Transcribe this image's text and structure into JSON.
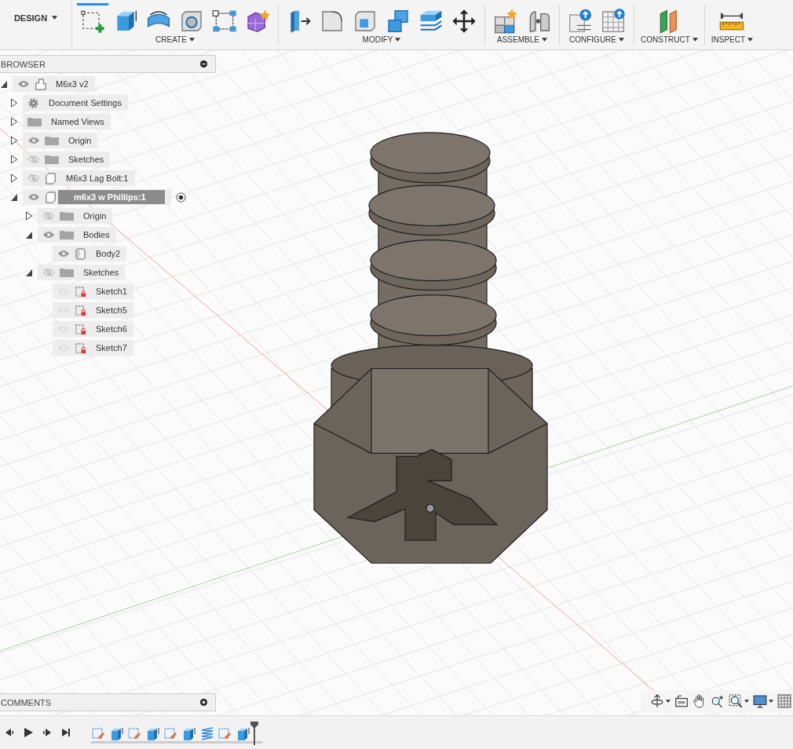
{
  "workspace": {
    "label": "DESIGN"
  },
  "toolbar": [
    {
      "label": "CREATE",
      "tools": [
        {
          "kind": "sketch",
          "selected": true
        },
        {
          "kind": "extrude",
          "selected": false
        },
        {
          "kind": "revolve",
          "selected": false
        },
        {
          "kind": "hole",
          "selected": false
        },
        {
          "kind": "pattern",
          "selected": false
        },
        {
          "kind": "form",
          "selected": false
        }
      ]
    },
    {
      "label": "MODIFY",
      "tools": [
        {
          "kind": "presspull",
          "selected": false
        },
        {
          "kind": "fillet",
          "selected": false
        },
        {
          "kind": "shell",
          "selected": false
        },
        {
          "kind": "combine",
          "selected": false
        },
        {
          "kind": "layers",
          "selected": false
        },
        {
          "kind": "move",
          "selected": false
        }
      ]
    },
    {
      "label": "ASSEMBLE",
      "tools": [
        {
          "kind": "component",
          "selected": false
        },
        {
          "kind": "joint",
          "selected": false
        }
      ]
    },
    {
      "label": "CONFIGURE",
      "tools": [
        {
          "kind": "parameters",
          "selected": false
        },
        {
          "kind": "table",
          "selected": false
        }
      ]
    },
    {
      "label": "CONSTRUCT",
      "tools": [
        {
          "kind": "plane",
          "selected": false
        }
      ]
    },
    {
      "label": "INSPECT",
      "tools": [
        {
          "kind": "measure",
          "selected": false
        }
      ]
    }
  ],
  "browser": {
    "title": "BROWSER",
    "items": [
      {
        "label": "M6x3 v2",
        "kind": "document",
        "visible": true,
        "dimmed": false,
        "expanded": true,
        "selected": false,
        "children": [
          {
            "label": "Document Settings",
            "kind": "settings",
            "expanded": false,
            "selected": false
          },
          {
            "label": "Named Views",
            "kind": "folder",
            "expanded": false,
            "selected": false
          },
          {
            "label": "Origin",
            "kind": "folder",
            "visible": true,
            "dimmed": false,
            "expanded": false,
            "selected": false
          },
          {
            "label": "Sketches",
            "kind": "folder",
            "visible": false,
            "dimmed": false,
            "expanded": false,
            "selected": false
          },
          {
            "label": "M6x3 Lag Bolt:1",
            "kind": "component",
            "visible": false,
            "dimmed": false,
            "expanded": false,
            "selected": false
          },
          {
            "label": "m6x3 w Phillips:1",
            "kind": "component",
            "visible": true,
            "dimmed": false,
            "expanded": true,
            "selected": true,
            "children": [
              {
                "label": "Origin",
                "kind": "folder",
                "visible": false,
                "dimmed": false,
                "expanded": false,
                "selected": false
              },
              {
                "label": "Bodies",
                "kind": "folder",
                "visible": true,
                "dimmed": false,
                "expanded": true,
                "selected": false,
                "children": [
                  {
                    "label": "Body2",
                    "kind": "body",
                    "visible": true,
                    "dimmed": false,
                    "selected": false
                  }
                ]
              },
              {
                "label": "Sketches",
                "kind": "folder",
                "visible": false,
                "dimmed": false,
                "expanded": true,
                "selected": false,
                "children": [
                  {
                    "label": "Sketch1",
                    "kind": "sketch",
                    "visible": true,
                    "dimmed": true,
                    "selected": false
                  },
                  {
                    "label": "Sketch5",
                    "kind": "sketch",
                    "visible": true,
                    "dimmed": true,
                    "selected": false
                  },
                  {
                    "label": "Sketch6",
                    "kind": "sketch",
                    "visible": true,
                    "dimmed": true,
                    "selected": false
                  },
                  {
                    "label": "Sketch7",
                    "kind": "sketch",
                    "visible": true,
                    "dimmed": true,
                    "selected": false
                  }
                ]
              }
            ]
          }
        ]
      }
    ]
  },
  "comments": {
    "title": "COMMENTS"
  },
  "timeline": [
    {
      "kind": "sketch"
    },
    {
      "kind": "extrude"
    },
    {
      "kind": "sketch"
    },
    {
      "kind": "extrude"
    },
    {
      "kind": "sketch"
    },
    {
      "kind": "extrude"
    },
    {
      "kind": "coil"
    },
    {
      "kind": "sketch"
    },
    {
      "kind": "extrude"
    }
  ]
}
